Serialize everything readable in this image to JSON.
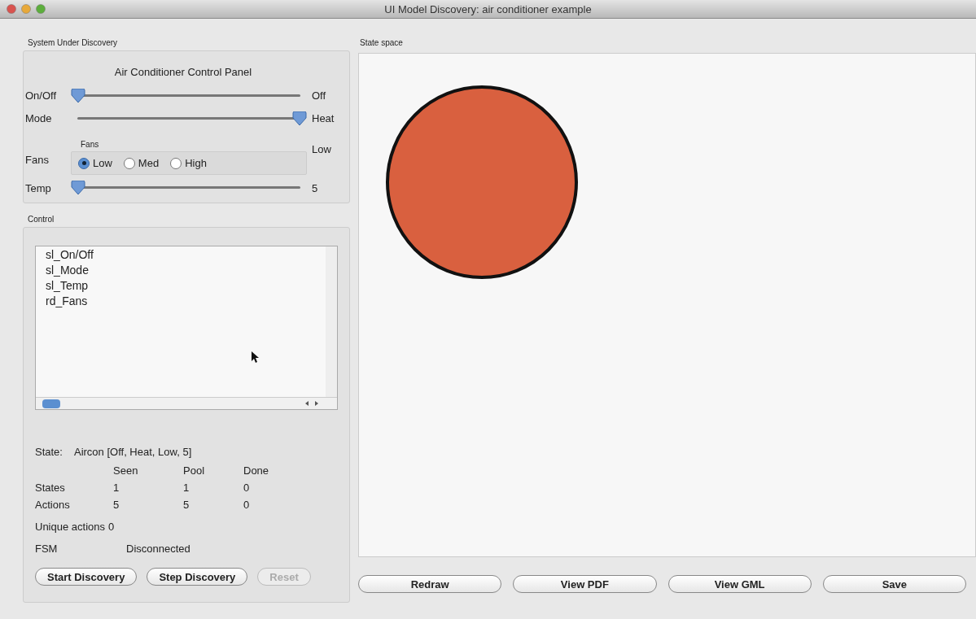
{
  "window": {
    "title": "UI Model Discovery: air conditioner example"
  },
  "system_panel": {
    "title": "System Under Discovery",
    "heading": "Air Conditioner Control Panel",
    "controls": [
      {
        "kind": "slider",
        "label": "On/Off",
        "level": 0,
        "reading": "Off"
      },
      {
        "kind": "slider",
        "label": "Mode",
        "level": 1,
        "reading": "Heat"
      },
      {
        "kind": "radio_group",
        "label": "Fans",
        "group_title": "Fans",
        "options": [
          {
            "label": "Low",
            "selected": true
          },
          {
            "label": "Med",
            "selected": false
          },
          {
            "label": "High",
            "selected": false
          }
        ],
        "reading": "Low"
      },
      {
        "kind": "slider",
        "label": "Temp",
        "level": 0,
        "reading": "5"
      }
    ]
  },
  "control_panel": {
    "title": "Control",
    "items": [
      "sl_On/Off",
      "sl_Mode",
      "sl_Temp",
      "rd_Fans"
    ]
  },
  "status": {
    "state_label": "State:",
    "state_value": "Aircon [Off, Heat, Low, 5]",
    "columns": [
      "Seen",
      "Pool",
      "Done"
    ],
    "rows": [
      {
        "label": "States",
        "values": [
          "1",
          "1",
          "0"
        ]
      },
      {
        "label": "Actions",
        "values": [
          "5",
          "5",
          "0"
        ]
      }
    ],
    "unique_label": "Unique actions",
    "unique_value": "0",
    "fsm_label": "FSM",
    "fsm_value": "Disconnected"
  },
  "buttons": [
    {
      "label": "Start Discovery",
      "disabled": false
    },
    {
      "label": "Step Discovery",
      "disabled": false
    },
    {
      "label": "Reset",
      "disabled": true
    }
  ],
  "state_space": {
    "title": "State space",
    "buttons": [
      "Redraw",
      "View PDF",
      "View GML",
      "Save"
    ]
  }
}
